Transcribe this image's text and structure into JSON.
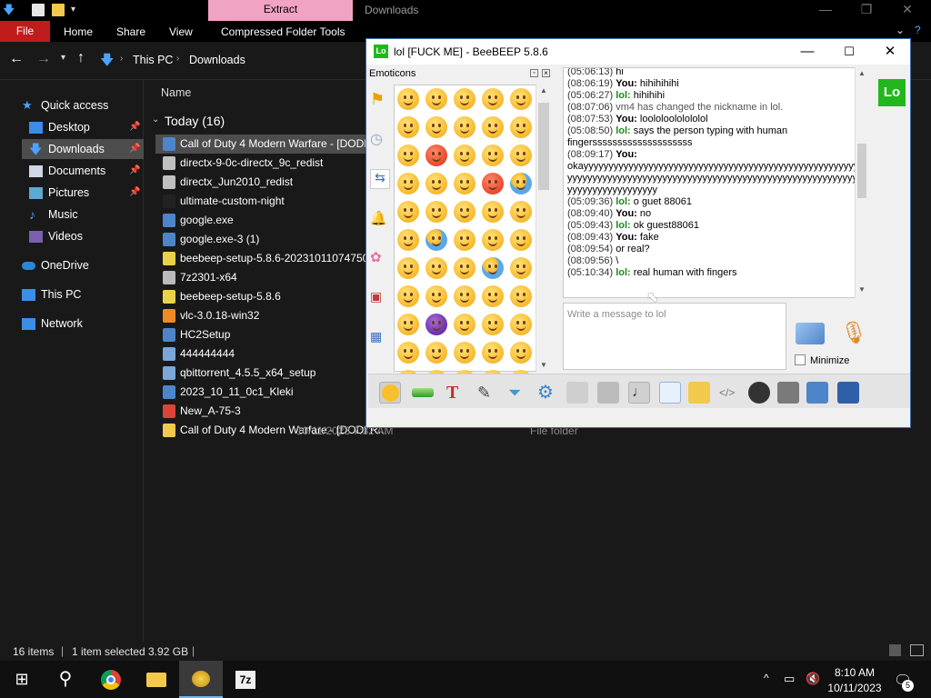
{
  "explorer": {
    "title": "Downloads",
    "context_tab": "Extract",
    "ribbon": {
      "file": "File",
      "tabs": [
        "Home",
        "Share",
        "View",
        "Compressed Folder Tools"
      ]
    },
    "breadcrumb": [
      "This PC",
      "Downloads"
    ],
    "column_name": "Name",
    "group_label": "Today (16)",
    "nav": [
      {
        "label": "Quick access",
        "icon": "star-icon"
      },
      {
        "label": "Desktop",
        "icon": "desktop-icon",
        "pinned": true
      },
      {
        "label": "Downloads",
        "icon": "download-icon",
        "pinned": true,
        "selected": true
      },
      {
        "label": "Documents",
        "icon": "documents-icon",
        "pinned": true
      },
      {
        "label": "Pictures",
        "icon": "pictures-icon",
        "pinned": true
      },
      {
        "label": "Music",
        "icon": "music-icon"
      },
      {
        "label": "Videos",
        "icon": "videos-icon"
      },
      {
        "label": "OneDrive",
        "icon": "onedrive-icon"
      },
      {
        "label": "This PC",
        "icon": "pc-icon"
      },
      {
        "label": "Network",
        "icon": "network-icon"
      }
    ],
    "files": [
      {
        "name": "Call of Duty 4 Modern Warfare - [DODI",
        "selected": true
      },
      {
        "name": "directx-9-0c-directx_9c_redist"
      },
      {
        "name": "directx_Jun2010_redist"
      },
      {
        "name": "ultimate-custom-night"
      },
      {
        "name": "google.exe"
      },
      {
        "name": "google.exe-3 (1)"
      },
      {
        "name": "beebeep-setup-5.8.6-20231011074750"
      },
      {
        "name": "7z2301-x64"
      },
      {
        "name": "beebeep-setup-5.8.6"
      },
      {
        "name": "vlc-3.0.18-win32"
      },
      {
        "name": "HC2Setup"
      },
      {
        "name": "444444444"
      },
      {
        "name": "qbittorrent_4.5.5_x64_setup"
      },
      {
        "name": "2023_10_11_0c1_Kleki"
      },
      {
        "name": "New_A-75-3"
      },
      {
        "name": "Call of Duty 4 Modern Warfare - [DODI R...",
        "date": "10/11/2023 7:32 AM",
        "type": "File folder"
      }
    ],
    "status": {
      "items": "16 items",
      "selected": "1 item selected  3.92 GB"
    }
  },
  "beebeep": {
    "title": "lol [FUCK ME] - BeeBEEP 5.8.6",
    "badge": "Lo",
    "emoticons_label": "Emoticons",
    "input_placeholder": "Write a message to lol",
    "minimize_label": "Minimize",
    "messages": [
      {
        "ts": "(05:06:13)",
        "who": "",
        "text": "hi"
      },
      {
        "ts": "(08:06:19)",
        "who": "You:",
        "text": "hihihihihi"
      },
      {
        "ts": "(05:06:27)",
        "who": "lol:",
        "text": "hihihihi"
      },
      {
        "ts": "(08:07:06)",
        "who": "",
        "text": "vm4 has changed the nickname in lol.",
        "system": true
      },
      {
        "ts": "(08:07:53)",
        "who": "You:",
        "text": "loololoololololol"
      },
      {
        "ts": "(05:08:50)",
        "who": "lol:",
        "text": "says the person typing with human"
      },
      {
        "ts": "",
        "who": "",
        "text": "fingerssssssssssssssssssss"
      },
      {
        "ts": "(08:09:17)",
        "who": "You:",
        "text": ""
      },
      {
        "ts": "",
        "who": "",
        "text": "okayyyyyyyyyyyyyyyyyyyyyyyyyyyyyyyyyyyyyyyyyyyyyyyyyyyyyyyyyy"
      },
      {
        "ts": "",
        "who": "",
        "text": "yyyyyyyyyyyyyyyyyyyyyyyyyyyyyyyyyyyyyyyyyyyyyyyyyyyyyyyyyyyyyyy"
      },
      {
        "ts": "",
        "who": "",
        "text": "yyyyyyyyyyyyyyyyyy"
      },
      {
        "ts": "(05:09:36)",
        "who": "lol:",
        "text": "o guet 88061"
      },
      {
        "ts": "(08:09:40)",
        "who": "You:",
        "text": "no"
      },
      {
        "ts": "(05:09:43)",
        "who": "lol:",
        "text": "ok guest88061"
      },
      {
        "ts": "(08:09:43)",
        "who": "You:",
        "text": "fake"
      },
      {
        "ts": "(08:09:54)",
        "who": "",
        "text": "or real?"
      },
      {
        "ts": "(08:09:56)",
        "who": "",
        "text": "\\"
      },
      {
        "ts": "(05:10:34)",
        "who": "lol:",
        "text": "real human with fingers"
      }
    ]
  },
  "taskbar": {
    "time": "8:10 AM",
    "date": "10/11/2023",
    "notifications": "5",
    "apps": [
      "start-icon",
      "search-icon",
      "chrome-icon",
      "file-explorer-icon",
      "beebeep-icon",
      "7zip-icon"
    ]
  },
  "colors": {
    "accent": "#0078d7",
    "file_tab": "#c11c1c",
    "extract_tab": "#f1a3c3",
    "beebeep_green": "#22b71d"
  }
}
